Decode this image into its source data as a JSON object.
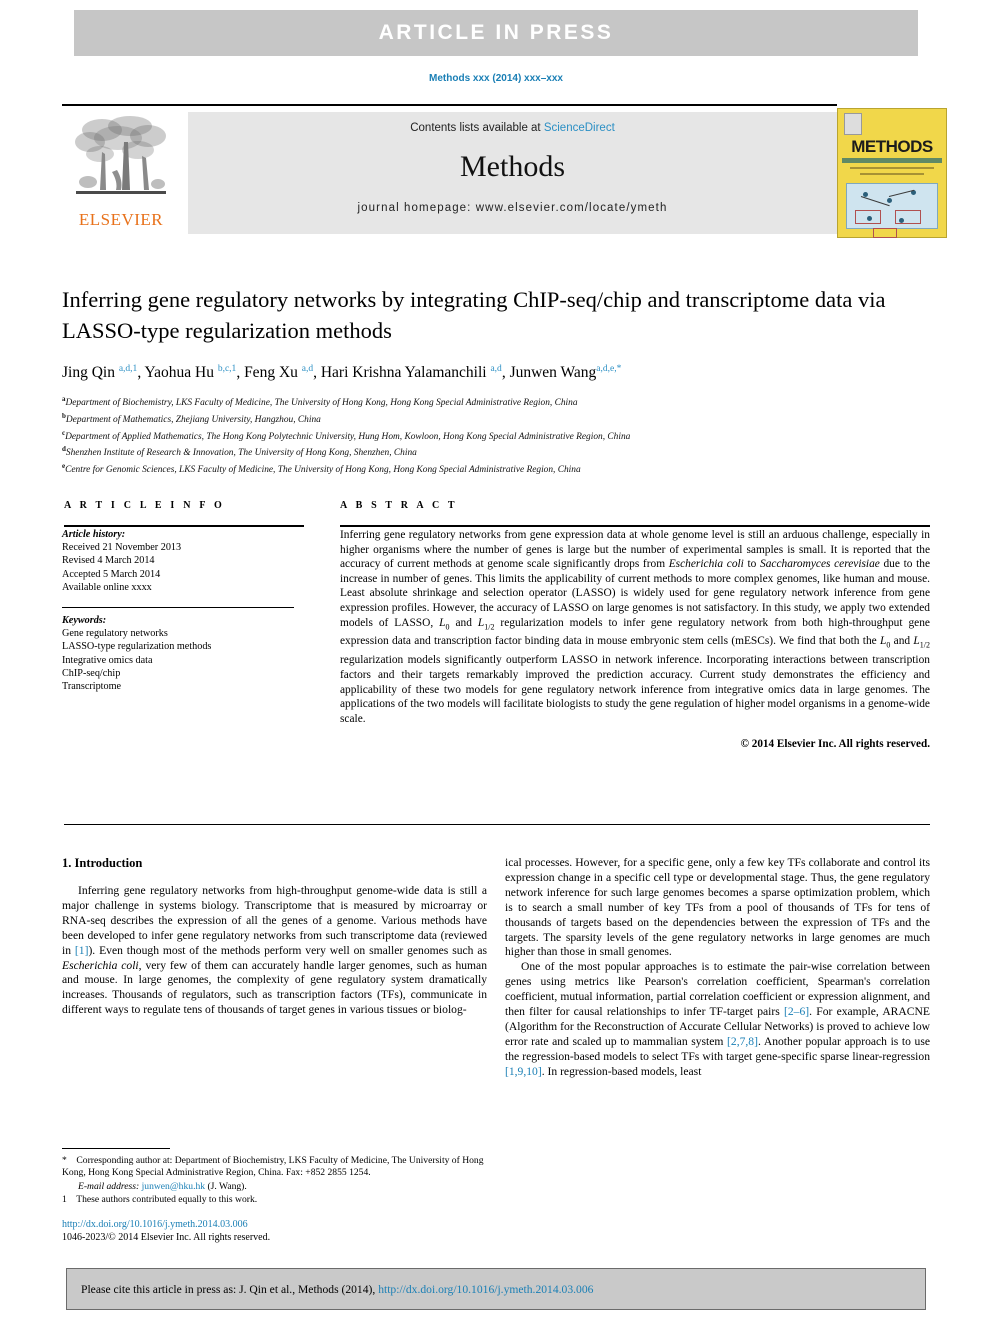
{
  "banner": {
    "text": "ARTICLE  IN  PRESS"
  },
  "running_head": "Methods xxx (2014) xxx–xxx",
  "journal_header": {
    "contents_prefix": "Contents lists available at ",
    "sciencedirect": "ScienceDirect",
    "journal_title": "Methods",
    "homepage": "journal homepage: www.elsevier.com/locate/ymeth",
    "publisher": "ELSEVIER",
    "cover_title": "METHODS"
  },
  "article": {
    "title": "Inferring gene regulatory networks by integrating ChIP-seq/chip and transcriptome data via LASSO-type regularization methods",
    "authors_html": "Jing Qin <sup>a,d,1</sup>, Yaohua Hu <sup>b,c,1</sup>, Feng Xu <sup>a,d</sup>, Hari Krishna Yalamanchili <sup>a,d</sup>, Junwen Wang<sup>a,d,e,*</sup>",
    "affiliations": [
      {
        "mark": "a",
        "text": "Department of Biochemistry, LKS Faculty of Medicine, The University of Hong Kong, Hong Kong Special Administrative Region, China"
      },
      {
        "mark": "b",
        "text": "Department of Mathematics, Zhejiang University, Hangzhou, China"
      },
      {
        "mark": "c",
        "text": "Department of Applied Mathematics, The Hong Kong Polytechnic University, Hung Hom, Kowloon, Hong Kong Special Administrative Region, China"
      },
      {
        "mark": "d",
        "text": "Shenzhen Institute of Research & Innovation, The University of Hong Kong, Shenzhen, China"
      },
      {
        "mark": "e",
        "text": "Centre for Genomic Sciences, LKS Faculty of Medicine, The University of Hong Kong, Hong Kong Special Administrative Region, China"
      }
    ]
  },
  "headings": {
    "article_info": "A R T I C L E   I N F O",
    "abstract": "A B S T R A C T",
    "introduction": "1. Introduction"
  },
  "article_info": {
    "history_label": "Article history:",
    "history": [
      "Received 21 November 2013",
      "Revised 4 March 2014",
      "Accepted 5 March 2014",
      "Available online xxxx"
    ],
    "keywords_label": "Keywords:",
    "keywords": [
      "Gene regulatory networks",
      "LASSO-type regularization methods",
      "Integrative omics data",
      "ChIP-seq/chip",
      "Transcriptome"
    ]
  },
  "abstract": {
    "text_html": "Inferring gene regulatory networks from gene expression data at whole genome level is still an arduous challenge, especially in higher organisms where the number of genes is large but the number of experimental samples is small. It is reported that the accuracy of current methods at genome scale significantly drops from <i>Escherichia coli</i> to <i>Saccharomyces cerevisiae</i> due to the increase in number of genes. This limits the applicability of current methods to more complex genomes, like human and mouse. Least absolute shrinkage and selection operator (LASSO) is widely used for gene regulatory network inference from gene expression profiles. However, the accuracy of LASSO on large genomes is not satisfactory. In this study, we apply two extended models of LASSO, <i>L</i><sub>0</sub> and <i>L</i><sub>1/2</sub> regularization models to infer gene regulatory network from both high-throughput gene expression data and transcription factor binding data in mouse embryonic stem cells (mESCs). We find that both the <i>L</i><sub>0</sub> and <i>L</i><sub>1/2</sub> regularization models significantly outperform LASSO in network inference. Incorporating interactions between transcription factors and their targets remarkably improved the prediction accuracy. Current study demonstrates the efficiency and applicability of these two models for gene regulatory network inference from integrative omics data in large genomes. The applications of the two models will facilitate biologists to study the gene regulation of higher model organisms in a genome-wide scale.",
    "copyright": "© 2014 Elsevier Inc. All rights reserved."
  },
  "body": {
    "left_html": "<p>Inferring gene regulatory networks from high-throughput genome-wide data is still a major challenge in systems biology. Transcriptome that is measured by microarray or RNA-seq describes the expression of all the genes of a genome. Various methods have been developed to infer gene regulatory networks from such transcriptome data (reviewed in <span class=\"ref\">[1]</span>). Even though most of the methods perform very well on smaller genomes such as <i>Escherichia coli</i>, very few of them can accurately handle larger genomes, such as human and mouse. In large genomes, the complexity of gene regulatory system dramatically increases. Thousands of regulators, such as transcription factors (TFs), communicate in different ways to regulate tens of thousands of target genes in various tissues or biolog-</p>",
    "right_html": "<p class=\"cont\">ical processes. However, for a specific gene, only a few key TFs collaborate and control its expression change in a specific cell type or developmental stage. Thus, the gene regulatory network inference for such large genomes becomes a sparse optimization problem, which is to search a small number of key TFs from a pool of thousands of TFs for tens of thousands of targets based on the dependencies between the expression of TFs and the targets. The sparsity levels of the gene regulatory networks in large genomes are much higher than those in small genomes.</p><p>One of the most popular approaches is to estimate the pair-wise correlation between genes using metrics like Pearson's correlation coefficient, Spearman's correlation coefficient, mutual information, partial correlation coefficient or expression alignment, and then filter for causal relationships to infer TF-target pairs <span class=\"ref\">[2–6]</span>. For example, ARACNE (Algorithm for the Reconstruction of Accurate Cellular Networks) is proved to achieve low error rate and scaled up to mammalian system <span class=\"ref\">[2,7,8]</span>. Another popular approach is to use the regression-based models to select TFs with target gene-specific sparse linear-regression <span class=\"ref\">[1,9,10]</span>. In regression-based models, least</p>"
  },
  "footnotes": {
    "corresponding_html": "<span class=\"mark\">*</span> Corresponding author at: Department of Biochemistry, LKS Faculty of Medicine, The University of Hong Kong, Hong Kong Special Administrative Region, China. Fax: +852 2855 1254.",
    "email_html": "<span class=\"email\">E-mail address:</span> <a href=\"#\">junwen@hku.hk</a> (J. Wang).",
    "equal_html": "<span class=\"mark\">1</span> These authors contributed equally to this work."
  },
  "doi_block": {
    "doi": "http://dx.doi.org/10.1016/j.ymeth.2014.03.006",
    "issn_line": "1046-2023/© 2014 Elsevier Inc. All rights reserved."
  },
  "cite_footer": {
    "prefix": "Please cite this article in press as: J. Qin et al., Methods (2014), ",
    "link": "http://dx.doi.org/10.1016/j.ymeth.2014.03.006"
  },
  "colors": {
    "banner_gray": "#c6c6c6",
    "header_gray": "#e6e6e6",
    "link_blue": "#1a7fb5",
    "elsevier_orange": "#e8711a",
    "cover_yellow": "#f1d74a",
    "cite_gray": "#c9c9c9"
  }
}
